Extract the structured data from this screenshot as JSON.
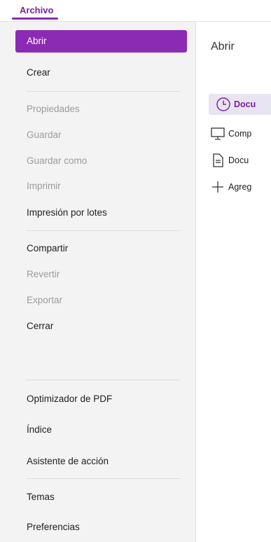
{
  "topbar": {
    "tab_label": "Archivo"
  },
  "sidebar": {
    "items": [
      {
        "label": "Abrir",
        "state": "selected"
      },
      {
        "label": "Crear",
        "state": "enabled"
      },
      {
        "label": "Propiedades",
        "state": "disabled"
      },
      {
        "label": "Guardar",
        "state": "disabled"
      },
      {
        "label": "Guardar como",
        "state": "disabled"
      },
      {
        "label": "Imprimir",
        "state": "disabled"
      },
      {
        "label": "Impresión por lotes",
        "state": "enabled"
      },
      {
        "label": "Compartir",
        "state": "enabled"
      },
      {
        "label": "Revertir",
        "state": "disabled"
      },
      {
        "label": "Exportar",
        "state": "disabled"
      },
      {
        "label": "Cerrar",
        "state": "enabled"
      },
      {
        "label": "Optimizador de PDF",
        "state": "enabled"
      },
      {
        "label": "Índice",
        "state": "enabled"
      },
      {
        "label": "Asistente de acción",
        "state": "enabled"
      },
      {
        "label": "Temas",
        "state": "enabled"
      },
      {
        "label": "Preferencias",
        "state": "enabled"
      }
    ]
  },
  "main": {
    "title": "Abrir",
    "options": [
      {
        "label": "Docu",
        "icon": "clock-icon",
        "selected": true
      },
      {
        "label": "Comp",
        "icon": "computer-icon",
        "selected": false
      },
      {
        "label": "Docu",
        "icon": "document-icon",
        "selected": false
      },
      {
        "label": "Agreg",
        "icon": "add-icon",
        "selected": false
      }
    ]
  },
  "colors": {
    "accent": "#8b2bb4",
    "accent_text": "#7a1fa2",
    "selected_bg": "#e8e4f1"
  }
}
